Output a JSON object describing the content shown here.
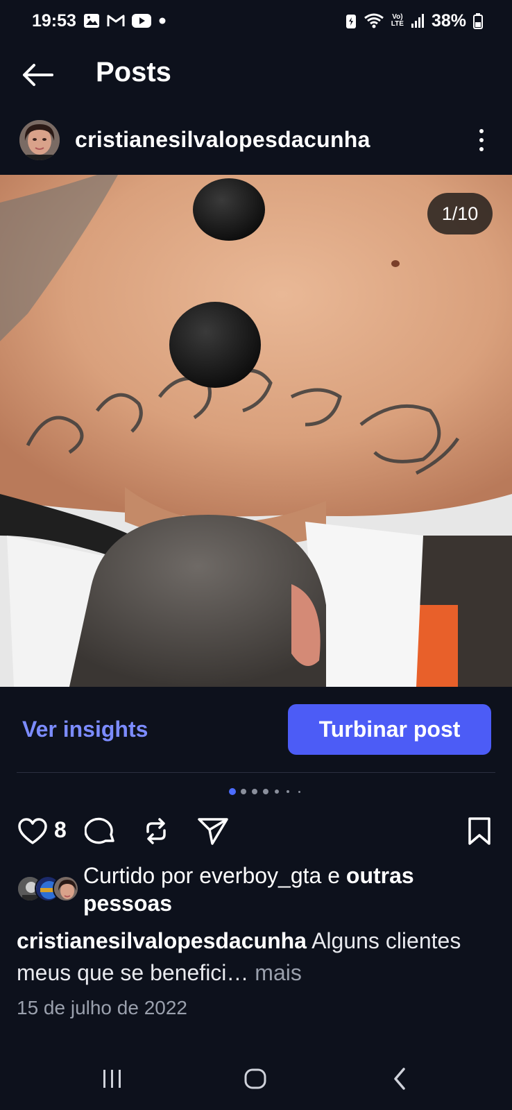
{
  "status_bar": {
    "time": "19:53",
    "battery": "38%",
    "network": "LTE"
  },
  "header": {
    "title": "Posts"
  },
  "post": {
    "username": "cristianesilvalopesdacunha",
    "image_counter": "1/10",
    "carousel": {
      "total": 10,
      "current": 1
    },
    "insights_label": "Ver insights",
    "boost_label": "Turbinar post",
    "like_count": "8",
    "liked_by_prefix": "Curtido por ",
    "liked_by_user": "everboy_gta",
    "liked_by_and": " e ",
    "liked_by_others": "outras pessoas",
    "caption_user": "cristianesilvalopesdacunha",
    "caption_text": " Alguns clientes meus que se benefici… ",
    "caption_more": "mais",
    "date": "15 de julho de 2022"
  },
  "icons": {
    "back": "arrow-left-icon",
    "more": "more-vertical-icon",
    "like": "heart-icon",
    "comment": "comment-icon",
    "repost": "repost-icon",
    "share": "send-icon",
    "save": "bookmark-icon"
  },
  "colors": {
    "background": "#0d111c",
    "accent": "#4c5cf6",
    "link": "#7c8cff",
    "muted": "#9aa0ad"
  }
}
